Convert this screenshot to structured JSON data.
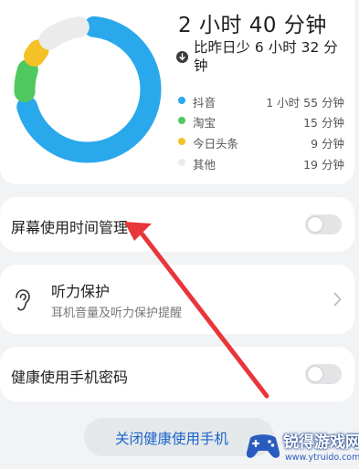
{
  "summary": {
    "total_time": "2 小时 40 分钟",
    "delta_text": "比昨日少 6 小时 32 分钟",
    "delta_icon": "down-arrow-icon",
    "apps": [
      {
        "name": "抖音",
        "duration": "1 小时 55 分钟",
        "minutes": 115,
        "color": "#29a8ec"
      },
      {
        "name": "淘宝",
        "duration": "15 分钟",
        "minutes": 15,
        "color": "#50c860"
      },
      {
        "name": "今日头条",
        "duration": "9 分钟",
        "minutes": 9,
        "color": "#f4c226"
      },
      {
        "name": "其他",
        "duration": "19 分钟",
        "minutes": 19,
        "color": "#ebebeb"
      }
    ]
  },
  "settings": {
    "screen_time_label": "屏幕使用时间管理",
    "screen_time_enabled": false,
    "hearing_title": "听力保护",
    "hearing_subtitle": "耳机音量及听力保护提醒",
    "password_label": "健康使用手机密码",
    "password_enabled": false
  },
  "footer": {
    "close_button_label": "关闭健康使用手机"
  },
  "watermark": {
    "site_name": "锐得游戏网",
    "url": "www.ytruido.com"
  },
  "colors": {
    "annotation_arrow": "#e8363a",
    "link_text": "#1a63c9"
  }
}
